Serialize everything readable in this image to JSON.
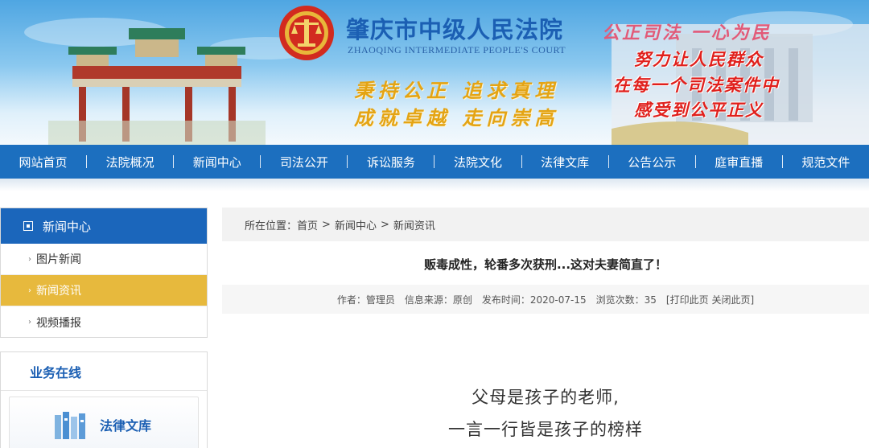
{
  "banner": {
    "court_name": "肇庆市中级人民法院",
    "court_name_en": "ZHAOQING INTERMEDIATE PEOPLE'S COURT",
    "slogan_line1": "秉持公正  追求真理",
    "slogan_line2": "成就卓越  走向崇高",
    "motto": "公正司法  一心为民",
    "red_lines": [
      "努力让人民群众",
      "在每一个司法案件中",
      "感受到公平正义"
    ],
    "icons": [
      "court-emblem-icon",
      "memorial-archway",
      "court-building"
    ]
  },
  "nav": {
    "items": [
      "网站首页",
      "法院概况",
      "新闻中心",
      "司法公开",
      "诉讼服务",
      "法院文化",
      "法律文库",
      "公告公示",
      "庭审直播",
      "规范文件"
    ]
  },
  "sidebar": {
    "news_title": "新闻中心",
    "news_items": [
      {
        "label": "图片新闻",
        "active": false
      },
      {
        "label": "新闻资讯",
        "active": true
      },
      {
        "label": "视频播报",
        "active": false
      }
    ],
    "biz_title": "业务在线",
    "biz_card_label": "法律文库"
  },
  "breadcrumb": {
    "prefix": "所在位置：",
    "items": [
      "首页",
      "新闻中心",
      "新闻资讯"
    ],
    "separator": ">"
  },
  "article": {
    "title": "贩毒成性，轮番多次获刑...这对夫妻简直了！",
    "meta": {
      "author": "作者：管理员",
      "source": "信息来源：原创",
      "date": "发布时间：2020-07-15",
      "views": "浏览次数：35",
      "print": "[打印此页",
      "close": "关闭此页]"
    },
    "body_lines": [
      "父母是孩子的老师,",
      "一言一行皆是孩子的榜样"
    ]
  },
  "colors": {
    "nav_blue": "#1c6fbf",
    "sidebar_head": "#1b66bb",
    "active_item": "#e7b93d",
    "title_blue": "#1b5fb3",
    "slogan_gold": "#e4a414",
    "motto_red": "#e0201c"
  }
}
